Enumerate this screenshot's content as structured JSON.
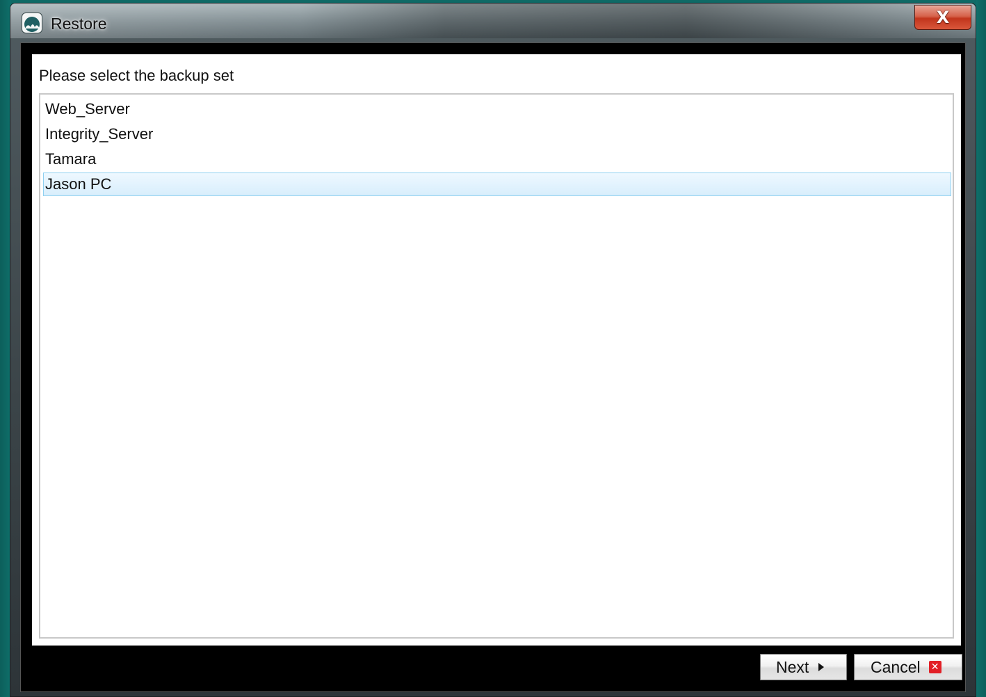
{
  "window": {
    "title": "Restore",
    "close_glyph": "X"
  },
  "prompt": "Please select the backup set",
  "backup_sets": [
    {
      "label": "Web_Server",
      "selected": false
    },
    {
      "label": "Integrity_Server",
      "selected": false
    },
    {
      "label": "Tamara",
      "selected": false
    },
    {
      "label": "Jason PC",
      "selected": true
    }
  ],
  "buttons": {
    "next_label": "Next",
    "cancel_label": "Cancel"
  },
  "icons": {
    "app": "app-logo-icon",
    "next": "arrow-right-icon",
    "cancel": "red-x-icon",
    "close": "close-icon"
  },
  "colors": {
    "desktop": "#0f6a66",
    "selection_border": "#8fd0f0",
    "selection_fill": "#d8eefc",
    "cancel_icon": "#e21f26",
    "close_button": "#c2351c"
  }
}
